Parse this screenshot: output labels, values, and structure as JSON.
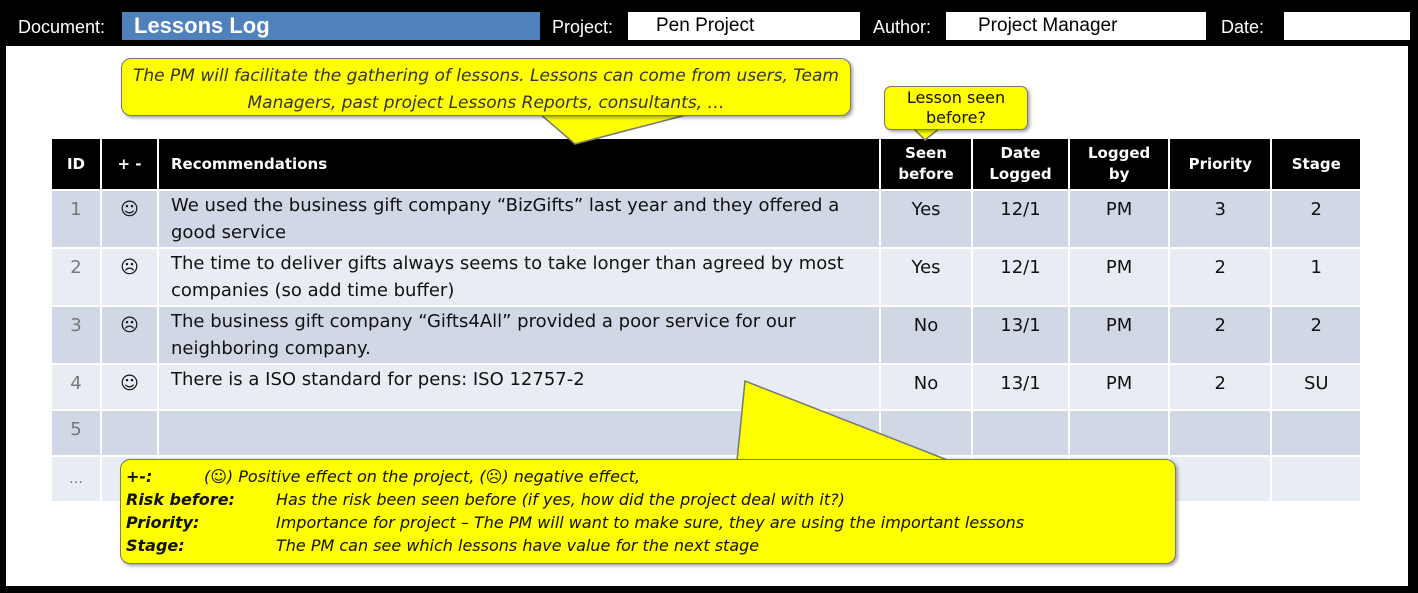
{
  "header": {
    "document_label": "Document:",
    "document_value": "Lessons Log",
    "project_label": "Project:",
    "project_value": "Pen Project",
    "author_label": "Author:",
    "author_value": "Project Manager",
    "date_label": "Date:",
    "date_value": ""
  },
  "callouts": {
    "gathering": "The PM will facilitate the gathering of lessons. Lessons can come from users, Team Managers, past project Lessons Reports, consultants, …",
    "seen_before": "Lesson seen before?"
  },
  "table": {
    "columns": [
      "ID",
      "+ -",
      "Recommendations",
      "Seen before",
      "Date Logged",
      "Logged by",
      "Priority",
      "Stage"
    ],
    "rows": [
      {
        "id": "1",
        "effect": "☺",
        "effect_icon": "smiley-happy-icon",
        "recommendation": "We used the business gift company “BizGifts” last year and they offered a good service",
        "seen_before": "Yes",
        "date_logged": "12/1",
        "logged_by": "PM",
        "priority": "3",
        "stage": "2"
      },
      {
        "id": "2",
        "effect": "☹",
        "effect_icon": "smiley-sad-icon",
        "recommendation": "The time to deliver gifts always seems to take longer than agreed by most companies (so add time buffer)",
        "seen_before": "Yes",
        "date_logged": "12/1",
        "logged_by": "PM",
        "priority": "2",
        "stage": "1"
      },
      {
        "id": "3",
        "effect": "☹",
        "effect_icon": "smiley-sad-icon",
        "recommendation": "The business gift company “Gifts4All” provided a poor service for our neighboring company.",
        "seen_before": "No",
        "date_logged": "13/1",
        "logged_by": "PM",
        "priority": "2",
        "stage": "2"
      },
      {
        "id": "4",
        "effect": "☺",
        "effect_icon": "smiley-happy-icon",
        "recommendation": "There is a ISO standard for pens: ISO 12757-2",
        "seen_before": "No",
        "date_logged": "13/1",
        "logged_by": "PM",
        "priority": "2",
        "stage": "SU"
      },
      {
        "id": "5",
        "effect": "",
        "effect_icon": "",
        "recommendation": "",
        "seen_before": "",
        "date_logged": "",
        "logged_by": "",
        "priority": "",
        "stage": ""
      },
      {
        "id": "…",
        "effect": "",
        "effect_icon": "",
        "recommendation": "",
        "seen_before": "",
        "date_logged": "",
        "logged_by": "",
        "priority": "",
        "stage": ""
      }
    ]
  },
  "legend": [
    {
      "key": "+-:",
      "value": "(☺) Positive effect on the project, (☹) negative effect,"
    },
    {
      "key": "Risk before:",
      "value": "Has the risk been seen before (if yes, how did the project deal with it?)"
    },
    {
      "key": "Priority:",
      "value": "Importance for project – The PM will want to make sure, they are using the important lessons"
    },
    {
      "key": "Stage:",
      "value": "The PM can see which lessons have value for the next stage"
    }
  ],
  "colors": {
    "title_bar": "#4f81bd",
    "callout": "#ffff00",
    "row_odd": "#d0d8e6",
    "row_even": "#e8edf4",
    "header_bg": "#000000"
  }
}
